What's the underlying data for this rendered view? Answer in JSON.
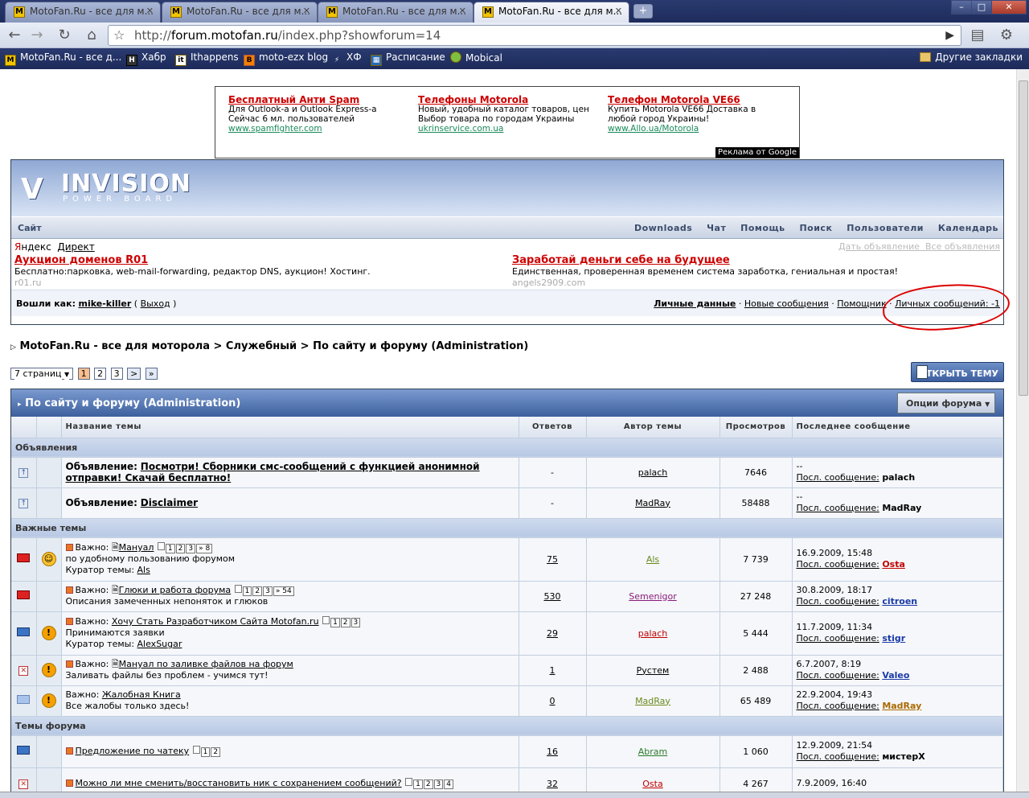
{
  "browser": {
    "tabs": [
      {
        "title": "MotoFan.Ru - все для м..."
      },
      {
        "title": "MotoFan.Ru - все для м..."
      },
      {
        "title": "MotoFan.Ru - все для м..."
      },
      {
        "title": "MotoFan.Ru - все для м..."
      }
    ],
    "url_prefix": "http://",
    "url_host": "forum.motofan.ru",
    "url_path": "/index.php?showforum=14",
    "bookmarks": [
      "MotoFan.Ru - все д...",
      "Хабр",
      "Ithappens",
      "moto-ezx blog",
      "ХФ",
      "Расписание",
      "Mobical"
    ],
    "other_bookmarks": "Другие закладки"
  },
  "ads": [
    {
      "title": "Бесплатный Анти Spam",
      "line1": "Для Outlook-а и Outlook Express-а",
      "line2": "Сейчас 6 мл. пользователей",
      "url": "www.spamfighter.com"
    },
    {
      "title": "Телефоны Motorola",
      "line1": "Новый, удобный каталог товаров, цен",
      "line2": "Выбор товара по городам Украины",
      "url": "ukrinservice.com.ua"
    },
    {
      "title": "Телефон Motorola VE66",
      "line1": "Купить Motorola VE66 Доставка в",
      "line2": "любой город Украины!",
      "url": "www.Allo.ua/Motorola"
    }
  ],
  "ads_badge": "Реклама от Google",
  "logo": {
    "name": "INVISION",
    "sub": "POWER BOARD"
  },
  "menu": {
    "site": "Сайт",
    "links": [
      "Downloads",
      "Чат",
      "Помощь",
      "Поиск",
      "Пользователи",
      "Календарь"
    ]
  },
  "yandex": {
    "y": "Я",
    "label": "ндекс",
    "direct": "Директ",
    "give_ad": "Дать объявление",
    "all_ads": "Все объявления",
    "ads": [
      {
        "title": "Аукцион доменов R01",
        "text": "Бесплатно:парковка, web-mail-forwarding, редактор DNS, аукцион! Хостинг.",
        "url": "r01.ru"
      },
      {
        "title": "Заработай деньги себе на будущее",
        "text": "Единственная, проверенная временем система заработка, гениальная и простая!",
        "url": "angels2909.com"
      }
    ]
  },
  "userbar": {
    "logged_as": "Вошли как:",
    "user": "mike-killer",
    "logout": "Выход",
    "links": [
      "Личные данные",
      "Новые сообщения",
      "Помощник",
      "Личных сообщений: -1"
    ]
  },
  "breadcrumb": "MotoFan.Ru - все для моторола > Служебный > По сайту и форуму (Administration)",
  "pager": {
    "pages_label": "7 страниц",
    "pages": [
      "1",
      "2",
      "3",
      ">",
      "»"
    ]
  },
  "new_topic": "ОТКРЫТЬ ТЕМУ",
  "forum": {
    "title": "По сайту и форуму (Administration)",
    "options": "Опции форума",
    "columns": [
      "Название темы",
      "Ответов",
      "Автор темы",
      "Просмотров",
      "Последнее сообщение"
    ],
    "last_label": "Посл. сообщение:",
    "sections": {
      "announcements": "Объявления",
      "important": "Важные темы",
      "topics": "Темы форума"
    },
    "announcements": [
      {
        "prefix": "Объявление:",
        "title": "Посмотри! Сборники смс-сообщений с функцией анонимной отправки! Скачай бесплатно!",
        "replies": "-",
        "author": "palach",
        "views": "7646",
        "last_date": "--",
        "last_user": "palach"
      },
      {
        "prefix": "Объявление:",
        "title": "Disclaimer",
        "replies": "-",
        "author": "MadRay",
        "views": "58488",
        "last_date": "--",
        "last_user": "MadRay"
      }
    ],
    "important": [
      {
        "prefix": "Важно:",
        "title": "Мануал",
        "pages": [
          "1",
          "2",
          "3",
          "» 8"
        ],
        "desc": "по удобному пользованию форумом",
        "curator": "Куратор темы: ",
        "curator_name": "Als",
        "replies": "75",
        "author": "Als",
        "views": "7 739",
        "last_date": "16.9.2009, 15:48",
        "last_user": "Osta"
      },
      {
        "prefix": "Важно:",
        "title": "Глюки и работа форума",
        "pages": [
          "1",
          "2",
          "3",
          "» 54"
        ],
        "desc": "Описания замеченных непоняток и глюков",
        "curator": "",
        "curator_name": "",
        "replies": "530",
        "author": "Semenigor",
        "views": "27 248",
        "last_date": "30.8.2009, 18:17",
        "last_user": "citroen"
      },
      {
        "prefix": "Важно:",
        "title": "Хочу Стать Разработчиком Сайта Motofan.ru",
        "pages": [
          "1",
          "2",
          "3"
        ],
        "desc": "Принимаются заявки",
        "curator": "Куратор темы: ",
        "curator_name": "AlexSugar",
        "replies": "29",
        "author": "palach",
        "views": "5 444",
        "last_date": "11.7.2009, 11:34",
        "last_user": "stigr"
      },
      {
        "prefix": "Важно:",
        "title": "Мануал по заливке файлов на форум",
        "pages": [],
        "desc": "Заливать файлы без проблем - учимся тут!",
        "curator": "",
        "curator_name": "",
        "replies": "1",
        "author": "Рустем",
        "views": "2 488",
        "last_date": "6.7.2007, 8:19",
        "last_user": "Valeo"
      },
      {
        "prefix": "Важно:",
        "title": "Жалобная Книга",
        "pages": [],
        "desc": "Все жалобы только здесь!",
        "curator": "",
        "curator_name": "",
        "replies": "0",
        "author": "MadRay",
        "views": "65 489",
        "last_date": "22.9.2004, 19:43",
        "last_user": "MadRay"
      }
    ],
    "topics": [
      {
        "title": "Предложение по чатеку",
        "pages": [
          "1",
          "2"
        ],
        "replies": "16",
        "author": "Abram",
        "views": "1 060",
        "last_date": "12.9.2009, 21:54",
        "last_user": "мистерX"
      },
      {
        "title": "Можно ли мне сменить/восстановить ник с сохранением сообщений?",
        "pages": [
          "1",
          "2",
          "3",
          "4"
        ],
        "replies": "32",
        "author": "Osta",
        "views": "4 267",
        "last_date": "7.9.2009, 16:40",
        "last_user": ""
      }
    ]
  },
  "colors": {
    "author_green": "#6a8a1e",
    "author_purple": "#8a1a7a",
    "author_red": "#c00000",
    "author_blue": "#1a3aa8",
    "last_orange": "#aa6a00"
  }
}
